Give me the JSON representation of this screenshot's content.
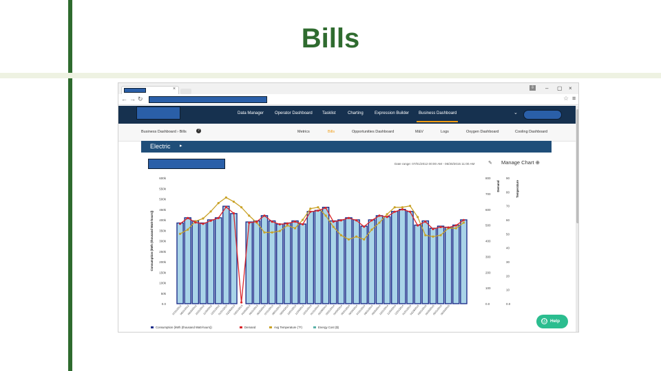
{
  "slide": {
    "title": "Bills"
  },
  "browser": {
    "tab": {
      "close": "×"
    },
    "controls": {
      "download": "⇩",
      "minimize": "–",
      "maximize": "▢",
      "close": "×"
    },
    "nav": {
      "back": "←",
      "forward": "→",
      "reload": "↻"
    },
    "star": "☆",
    "menu": "≡"
  },
  "app": {
    "nav": {
      "items": [
        "Data Manager",
        "Operator Dashboard",
        "Tasklist",
        "Charting",
        "Expression Builder",
        "Business Dashboard"
      ],
      "active": "Business Dashboard",
      "chevron": "⌄"
    },
    "breadcrumb": "Business Dashboard › Bills",
    "help_symbol": "?",
    "subtabs": [
      "Metrics",
      "Bills",
      "Opportunities Dashboard",
      "M&V",
      "Logs",
      "Oxygen Dashboard",
      "Cooling Dashboard"
    ],
    "active_subtab": "Bills",
    "panel": {
      "title": "Electric",
      "arrow": "▸"
    },
    "date_range": "Date range: 07/01/2012 00:00 AM - 06/30/2015 11:00 AM",
    "manage_chart": "Manage Chart ⊕",
    "pencil": "✎",
    "help_button": {
      "label": "Help",
      "icon": "ⓘ"
    }
  },
  "colors": {
    "consumption": "#1f2f8a",
    "consumption_fill": "#a9d4e8",
    "demand": "#d9262b",
    "temperature": "#c9a227",
    "energy_cost": "#5ab1a8",
    "nav_bg": "#16314f",
    "panel_head": "#1f4e79",
    "accent": "#f39c12"
  },
  "chart_data": {
    "type": "bar",
    "ylabel": "Consumption (kWh (thousand Watt-hours))",
    "y2label": "Demand",
    "y3label": "Temperature",
    "yticks": [
      "600k",
      "550k",
      "500k",
      "450k",
      "400k",
      "350k",
      "300k",
      "250k",
      "200k",
      "150k",
      "100k",
      "50k",
      "0.0"
    ],
    "y2ticks": [
      "800",
      "700",
      "600",
      "500",
      "400",
      "300",
      "200",
      "100",
      "0.0"
    ],
    "y3ticks": [
      "90",
      "80",
      "70",
      "60",
      "50",
      "40",
      "30",
      "20",
      "10",
      "0.0"
    ],
    "ylim": [
      0,
      600000
    ],
    "y2lim": [
      0,
      800
    ],
    "y3lim": [
      0,
      90
    ],
    "categories": [
      "07/31/2012",
      "08/31/2012",
      "09/30/2012",
      "10/31/2012",
      "11/30/2012",
      "12/31/2012",
      "01/31/2013",
      "02/28/2013",
      "03/31/2013",
      "04/30/2013",
      "05/31/2013",
      "06/30/2013",
      "07/31/2013",
      "08/31/2013",
      "09/30/2013",
      "10/31/2013",
      "11/30/2013",
      "12/31/2013",
      "01/31/2014",
      "02/28/2014",
      "03/31/2014",
      "04/30/2014",
      "05/31/2014",
      "06/30/2014",
      "07/31/2014",
      "08/31/2014",
      "09/30/2014",
      "10/31/2014",
      "11/30/2014",
      "12/31/2014",
      "01/31/2015",
      "02/28/2015",
      "03/31/2015",
      "04/30/2015",
      "05/31/2015",
      "06/30/2015"
    ],
    "series": [
      {
        "name": "Consumption (kWh (thousand Watt-hours))",
        "type": "bar",
        "axis": "left",
        "values": [
          385000,
          410000,
          395000,
          385000,
          400000,
          410000,
          465000,
          430000,
          0,
          390000,
          395000,
          420000,
          395000,
          380000,
          385000,
          395000,
          380000,
          440000,
          445000,
          460000,
          395000,
          400000,
          410000,
          400000,
          370000,
          400000,
          420000,
          415000,
          440000,
          450000,
          440000,
          375000,
          395000,
          360000,
          370000,
          365000,
          375000,
          400000
        ]
      },
      {
        "name": "Demand",
        "type": "line",
        "axis": "right",
        "values": [
          508,
          545,
          517,
          508,
          528,
          545,
          615,
          575,
          8,
          515,
          522,
          560,
          522,
          505,
          510,
          522,
          505,
          585,
          592,
          610,
          522,
          530,
          545,
          530,
          490,
          530,
          560,
          552,
          585,
          600,
          585,
          498,
          522,
          475,
          488,
          485,
          498,
          532
        ]
      },
      {
        "name": "Avg Temperature (°F)",
        "type": "line",
        "axis": "right2",
        "values": [
          50,
          53,
          59,
          61,
          66,
          72,
          76,
          73,
          69,
          63,
          58,
          51,
          51,
          52,
          56,
          54,
          60,
          68,
          69,
          63,
          55,
          49,
          46,
          48,
          46,
          53,
          58,
          64,
          69,
          69,
          70,
          62,
          49,
          48,
          49,
          54,
          54,
          58
        ]
      },
      {
        "name": "Energy Cost ($)",
        "type": "bar",
        "axis": "left",
        "values": []
      }
    ],
    "legend": [
      "Consumption (kWh (thousand Watt-hours))",
      "Demand",
      "Avg Temperature (°F)",
      "Energy Cost ($)"
    ]
  }
}
